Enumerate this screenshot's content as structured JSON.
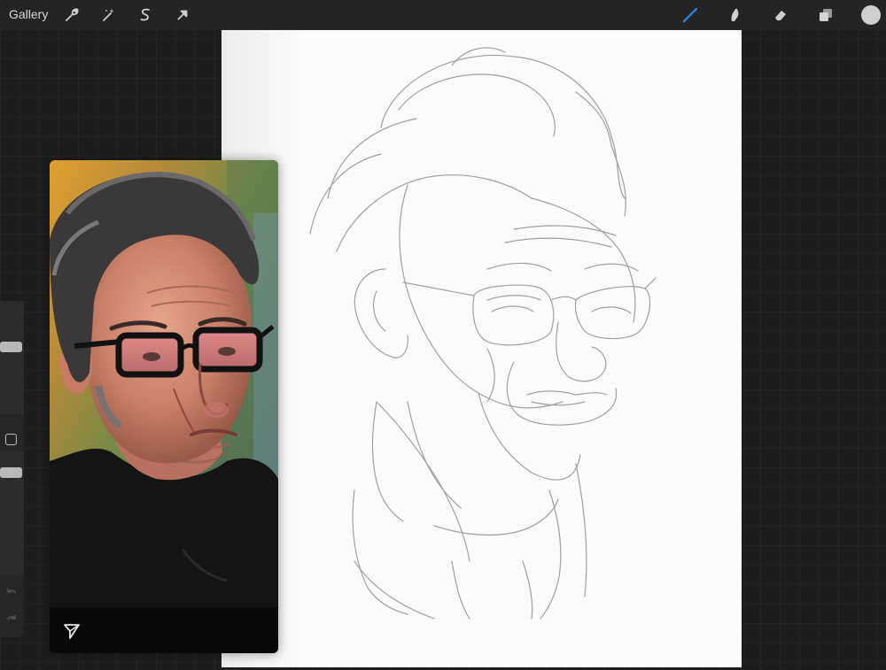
{
  "toolbar": {
    "gallery_label": "Gallery",
    "left_tools": [
      {
        "name": "actions",
        "icon": "wrench-icon"
      },
      {
        "name": "adjustments",
        "icon": "magic-wand-icon"
      },
      {
        "name": "selection",
        "icon": "selection-s-icon"
      },
      {
        "name": "transform",
        "icon": "arrow-cursor-icon"
      }
    ],
    "right_tools": [
      {
        "name": "brush",
        "icon": "brush-icon",
        "active": true
      },
      {
        "name": "smudge",
        "icon": "smudge-icon"
      },
      {
        "name": "eraser",
        "icon": "eraser-icon"
      },
      {
        "name": "layers",
        "icon": "layers-icon"
      }
    ],
    "active_color": "#cfcfcf",
    "accent_color": "#2f7fe0"
  },
  "sidebar": {
    "brush_size_level": 0.6,
    "opacity_level": 0.2,
    "modifier_icon": "square-modifier-icon",
    "undo_icon": "undo-icon",
    "redo_icon": "redo-icon"
  },
  "reference": {
    "footer_icon": "send-arrow-icon"
  }
}
